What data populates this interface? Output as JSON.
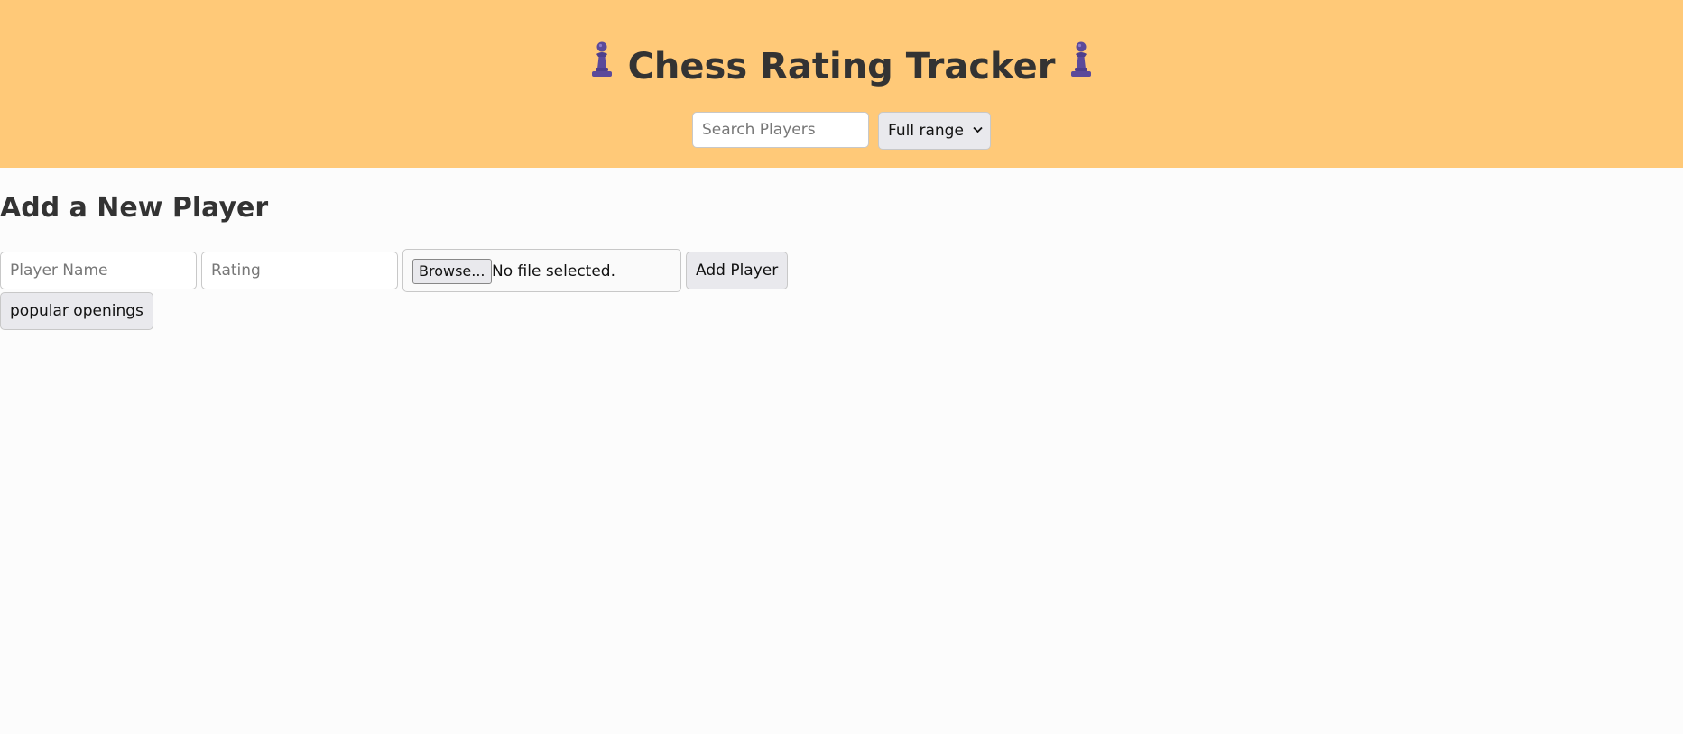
{
  "header": {
    "title": "Chess Rating Tracker",
    "icon_left": "pawn-icon",
    "icon_right": "pawn-icon",
    "background_color": "#ffc978"
  },
  "search": {
    "placeholder": "Search Players",
    "value": ""
  },
  "range_filter": {
    "selected": "Full range"
  },
  "add_player": {
    "heading": "Add a New Player",
    "name_placeholder": "Player Name",
    "rating_placeholder": "Rating",
    "browse_label": "Browse...",
    "file_status": "No file selected.",
    "add_label": "Add Player"
  },
  "openings_button": {
    "label": "popular openings"
  }
}
